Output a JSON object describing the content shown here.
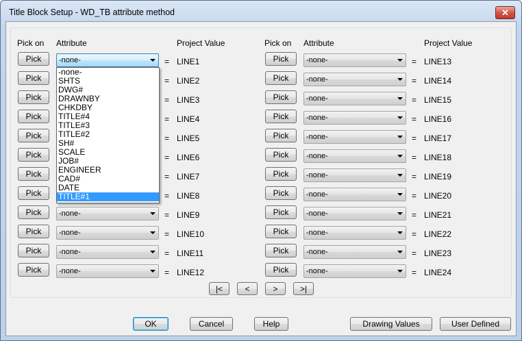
{
  "window": {
    "title": "Title Block Setup - WD_TB attribute method",
    "close_label": "✕"
  },
  "headers": {
    "pick_on": "Pick on",
    "attribute": "Attribute",
    "project_value": "Project Value"
  },
  "pick_label": "Pick",
  "equals": "=",
  "rows": [
    {
      "attr": "-none-",
      "value": "LINE1"
    },
    {
      "attr": "-none-",
      "value": "LINE2"
    },
    {
      "attr": "-none-",
      "value": "LINE3"
    },
    {
      "attr": "-none-",
      "value": "LINE4"
    },
    {
      "attr": "-none-",
      "value": "LINE5"
    },
    {
      "attr": "-none-",
      "value": "LINE6"
    },
    {
      "attr": "-none-",
      "value": "LINE7"
    },
    {
      "attr": "-none-",
      "value": "LINE8"
    },
    {
      "attr": "-none-",
      "value": "LINE9"
    },
    {
      "attr": "-none-",
      "value": "LINE10"
    },
    {
      "attr": "-none-",
      "value": "LINE11"
    },
    {
      "attr": "-none-",
      "value": "LINE12"
    },
    {
      "attr": "-none-",
      "value": "LINE13"
    },
    {
      "attr": "-none-",
      "value": "LINE14"
    },
    {
      "attr": "-none-",
      "value": "LINE15"
    },
    {
      "attr": "-none-",
      "value": "LINE16"
    },
    {
      "attr": "-none-",
      "value": "LINE17"
    },
    {
      "attr": "-none-",
      "value": "LINE18"
    },
    {
      "attr": "-none-",
      "value": "LINE19"
    },
    {
      "attr": "-none-",
      "value": "LINE20"
    },
    {
      "attr": "-none-",
      "value": "LINE21"
    },
    {
      "attr": "-none-",
      "value": "LINE22"
    },
    {
      "attr": "-none-",
      "value": "LINE23"
    },
    {
      "attr": "-none-",
      "value": "LINE24"
    }
  ],
  "dropdown": {
    "options": [
      "-none-",
      "SHTS",
      "DWG#",
      "DRAWNBY",
      "CHKDBY",
      "TITLE#4",
      "TITLE#3",
      "TITLE#2",
      "SH#",
      "SCALE",
      "JOB#",
      "ENGINEER",
      "CAD#",
      "DATE",
      "TITLE#1"
    ],
    "highlighted": "TITLE#1"
  },
  "nav": {
    "first": "|<",
    "prev": "<",
    "next": ">",
    "last": ">|"
  },
  "buttons": {
    "ok": "OK",
    "cancel": "Cancel",
    "help": "Help",
    "drawing_values": "Drawing Values",
    "user_defined": "User Defined"
  }
}
